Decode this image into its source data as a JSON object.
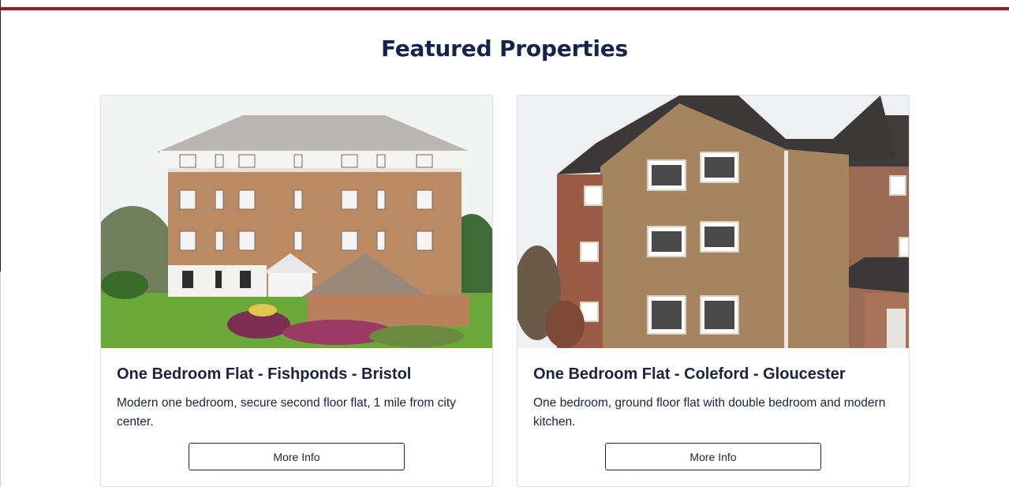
{
  "page": {
    "section_title": "Featured Properties",
    "accent_color": "#8b1e2b",
    "text_color": "#1b2340"
  },
  "properties": [
    {
      "title": "One Bedroom Flat - Fishponds - Bristol",
      "description": "Modern one bedroom, secure second floor flat, 1 mile from city center.",
      "button_label": "More Info",
      "image": "brick-apartment-building-photo"
    },
    {
      "title": "One Bedroom Flat - Coleford - Gloucester",
      "description": "One bedroom, ground floor flat with double bedroom and modern kitchen.",
      "button_label": "More Info",
      "image": "stone-house-photo"
    }
  ]
}
